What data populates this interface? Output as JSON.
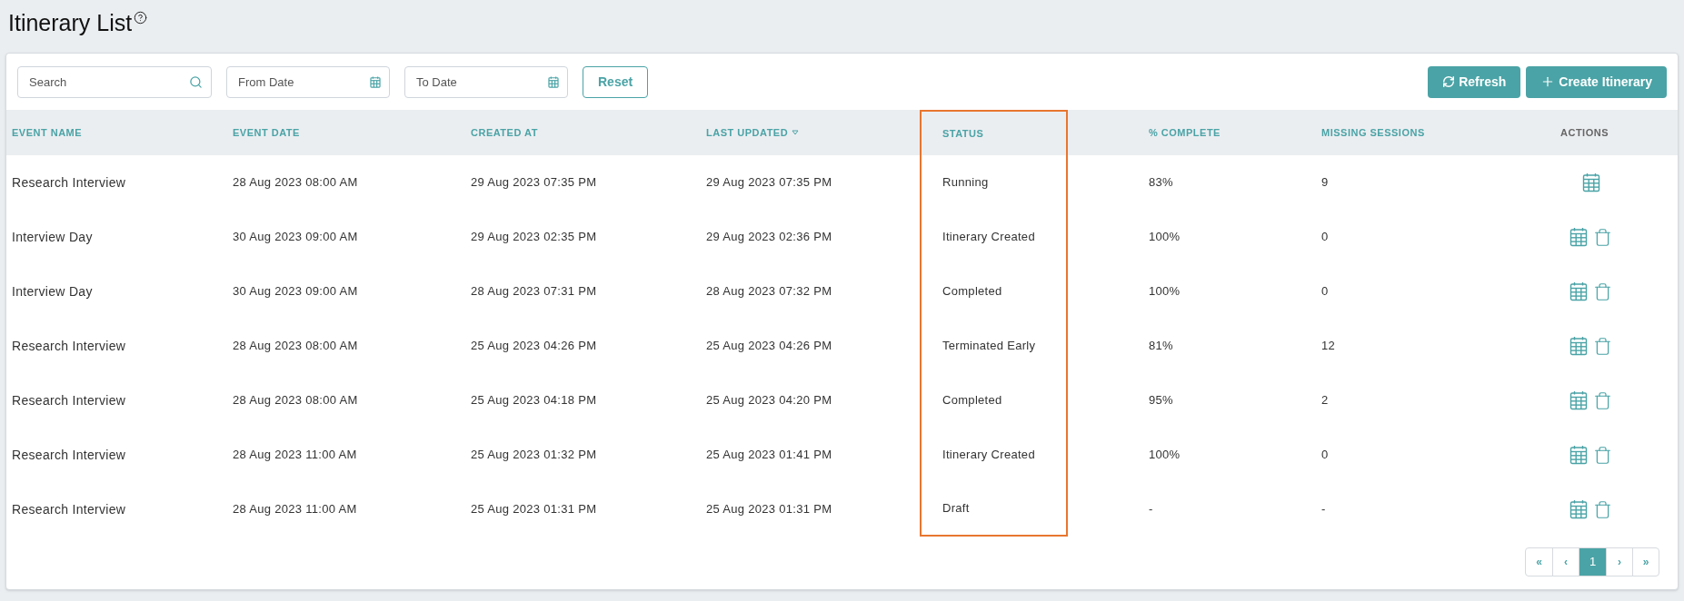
{
  "page": {
    "title": "Itinerary List"
  },
  "toolbar": {
    "search": {
      "placeholder": "Search"
    },
    "from_date": {
      "placeholder": "From Date"
    },
    "to_date": {
      "placeholder": "To Date"
    },
    "reset": "Reset",
    "refresh": "Refresh",
    "create": "Create Itinerary"
  },
  "table": {
    "columns": [
      {
        "label": "EVENT NAME",
        "sorted": false,
        "highlighted": false,
        "muted": false
      },
      {
        "label": "EVENT DATE",
        "sorted": false,
        "highlighted": false,
        "muted": false
      },
      {
        "label": "CREATED AT",
        "sorted": false,
        "highlighted": false,
        "muted": false
      },
      {
        "label": "LAST UPDATED",
        "sorted": true,
        "highlighted": false,
        "muted": false
      },
      {
        "label": "STATUS",
        "sorted": false,
        "highlighted": true,
        "muted": false
      },
      {
        "label": "% COMPLETE",
        "sorted": false,
        "highlighted": false,
        "muted": false
      },
      {
        "label": "MISSING SESSIONS",
        "sorted": false,
        "highlighted": false,
        "muted": false
      },
      {
        "label": "ACTIONS",
        "sorted": false,
        "highlighted": false,
        "muted": true
      }
    ],
    "rows": [
      {
        "cells": [
          "Research Interview",
          "28 Aug 2023 08:00 AM",
          "29 Aug 2023 07:35 PM",
          "29 Aug 2023 07:35 PM",
          "Running",
          "83%",
          "9"
        ],
        "deletable": false
      },
      {
        "cells": [
          "Interview Day",
          "30 Aug 2023 09:00 AM",
          "29 Aug 2023 02:35 PM",
          "29 Aug 2023 02:36 PM",
          "Itinerary Created",
          "100%",
          "0"
        ],
        "deletable": true
      },
      {
        "cells": [
          "Interview Day",
          "30 Aug 2023 09:00 AM",
          "28 Aug 2023 07:31 PM",
          "28 Aug 2023 07:32 PM",
          "Completed",
          "100%",
          "0"
        ],
        "deletable": true
      },
      {
        "cells": [
          "Research Interview",
          "28 Aug 2023 08:00 AM",
          "25 Aug 2023 04:26 PM",
          "25 Aug 2023 04:26 PM",
          "Terminated Early",
          "81%",
          "12"
        ],
        "deletable": true
      },
      {
        "cells": [
          "Research Interview",
          "28 Aug 2023 08:00 AM",
          "25 Aug 2023 04:18 PM",
          "25 Aug 2023 04:20 PM",
          "Completed",
          "95%",
          "2"
        ],
        "deletable": true
      },
      {
        "cells": [
          "Research Interview",
          "28 Aug 2023 11:00 AM",
          "25 Aug 2023 01:32 PM",
          "25 Aug 2023 01:41 PM",
          "Itinerary Created",
          "100%",
          "0"
        ],
        "deletable": true
      },
      {
        "cells": [
          "Research Interview",
          "28 Aug 2023 11:00 AM",
          "25 Aug 2023 01:31 PM",
          "25 Aug 2023 01:31 PM",
          "Draft",
          "-",
          "-"
        ],
        "deletable": true
      }
    ]
  },
  "pagination": [
    {
      "label": "«",
      "selected": false
    },
    {
      "label": "‹",
      "selected": false
    },
    {
      "label": "1",
      "selected": true
    },
    {
      "label": "›",
      "selected": false
    },
    {
      "label": "»",
      "selected": false
    }
  ]
}
